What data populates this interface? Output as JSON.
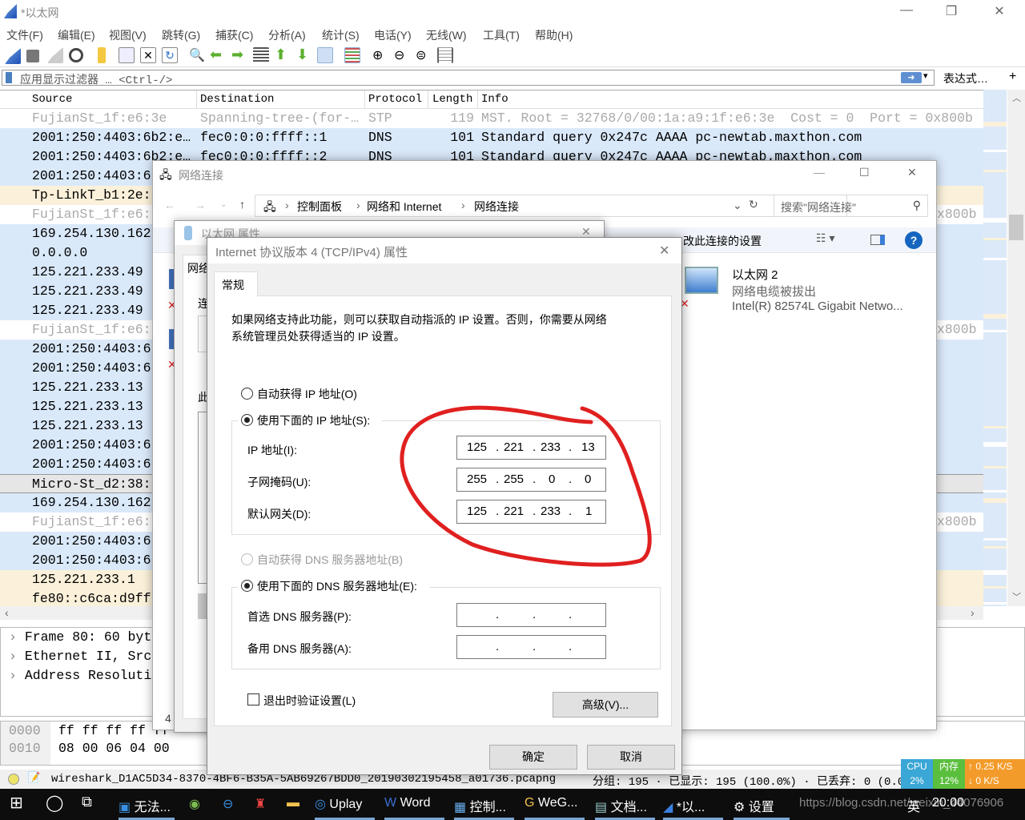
{
  "wireshark": {
    "title": "*以太网",
    "menu": [
      "文件(F)",
      "编辑(E)",
      "视图(V)",
      "跳转(G)",
      "捕获(C)",
      "分析(A)",
      "统计(S)",
      "电话(Y)",
      "无线(W)",
      "工具(T)",
      "帮助(H)"
    ],
    "filter_placeholder": "应用显示过滤器 … <Ctrl-/>",
    "expression_label": "表达式…",
    "plus_label": "+",
    "columns": {
      "source": "Source",
      "destination": "Destination",
      "protocol": "Protocol",
      "length": "Length",
      "info": "Info"
    },
    "row_colors": {
      "blue": "#dae9fa",
      "tan": "#fbf1da",
      "white": "#ffffff",
      "selected": "#e6e6e6"
    },
    "packets": [
      {
        "style": "white",
        "dim": true,
        "source": "FujianSt_1f:e6:3e",
        "destination": "Spanning-tree-(for-…",
        "protocol": "STP",
        "length": "119",
        "info": "MST. Root = 32768/0/00:1a:a9:1f:e6:3e  Cost = 0  Port = 0x800b"
      },
      {
        "style": "blue",
        "source": "2001:250:4403:6b2:e…",
        "destination": "fec0:0:0:ffff::1",
        "protocol": "DNS",
        "length": "101",
        "info": "Standard query 0x247c AAAA pc-newtab.maxthon.com"
      },
      {
        "style": "blue",
        "source": "2001:250:4403:6b2:e…",
        "destination": "fec0:0:0:ffff::2",
        "protocol": "DNS",
        "length": "101",
        "info": "Standard query 0x247c AAAA pc-newtab.maxthon.com"
      },
      {
        "style": "blue",
        "source": "2001:250:4403:6"
      },
      {
        "style": "tan",
        "source": "Tp-LinkT_b1:2e:"
      },
      {
        "style": "white",
        "dim": true,
        "source": "FujianSt_1f:e6:",
        "tail": "x800b"
      },
      {
        "style": "blue",
        "source": "169.254.130.162"
      },
      {
        "style": "blue",
        "source": "0.0.0.0"
      },
      {
        "style": "blue",
        "source": "125.221.233.49"
      },
      {
        "style": "blue",
        "source": "125.221.233.49"
      },
      {
        "style": "blue",
        "source": "125.221.233.49"
      },
      {
        "style": "white",
        "dim": true,
        "source": "FujianSt_1f:e6:",
        "tail": "x800b"
      },
      {
        "style": "blue",
        "source": "2001:250:4403:6"
      },
      {
        "style": "blue",
        "source": "2001:250:4403:6"
      },
      {
        "style": "blue",
        "source": "125.221.233.13"
      },
      {
        "style": "blue",
        "source": "125.221.233.13"
      },
      {
        "style": "blue",
        "source": "125.221.233.13"
      },
      {
        "style": "blue",
        "source": "2001:250:4403:6"
      },
      {
        "style": "blue",
        "source": "2001:250:4403:6"
      },
      {
        "style": "selected",
        "source": "Micro-St_d2:38:"
      },
      {
        "style": "blue",
        "source": "169.254.130.162"
      },
      {
        "style": "white",
        "dim": true,
        "source": "FujianSt_1f:e6:",
        "tail": "x800b"
      },
      {
        "style": "blue",
        "source": "2001:250:4403:6"
      },
      {
        "style": "blue",
        "source": "2001:250:4403:6"
      },
      {
        "style": "tan",
        "source": "125.221.233.1"
      },
      {
        "style": "tan",
        "source": "fe80::c6ca:d9ff"
      }
    ],
    "details": [
      "Frame 80: 60 byt",
      "Ethernet II, Src",
      "Address Resoluti"
    ],
    "bytes": [
      {
        "offset": "0000",
        "hex": "ff ff ff ff ff"
      },
      {
        "offset": "0010",
        "hex": "08 00 06 04 00"
      }
    ],
    "status_file": "wireshark_D1AC5D34-8370-4BF6-B35A-5AB69267BDD0_20190302195458_a01736.pcapng",
    "status_counts": "分组: 195 · 已显示: 195 (100.0%) · 已丢弃: 0 (0.0%)"
  },
  "monitor": {
    "cpu_label": "CPU",
    "cpu_value": "2%",
    "mem_label": "内存",
    "mem_value": "12%",
    "up": "0.25 K/S",
    "down": "0 K/S"
  },
  "network_window": {
    "title": "网络连接",
    "breadcrumb": [
      "控制面板",
      "网络和 Internet",
      "网络连接"
    ],
    "search_placeholder": "搜索\"网络连接\"",
    "command": "改此连接的设置",
    "adapter": {
      "name": "以太网 2",
      "status": "网络电缆被拔出",
      "device": "Intel(R) 82574L Gigabit Netwo..."
    },
    "item_count": "4"
  },
  "ethernet_props": {
    "title": "以太网 属性",
    "tab": "网络",
    "conn_label": "连",
    "items_label": "此"
  },
  "ipv4": {
    "title": "Internet 协议版本 4 (TCP/IPv4) 属性",
    "tab": "常规",
    "description": [
      "如果网络支持此功能，则可以获取自动指派的 IP 设置。否则，你需要从网络",
      "系统管理员处获得适当的 IP 设置。"
    ],
    "auto_ip": "自动获得 IP 地址(O)",
    "manual_ip": "使用下面的 IP 地址(S):",
    "ip_label": "IP 地址(I):",
    "ip": [
      "125",
      "221",
      "233",
      "13"
    ],
    "mask_label": "子网掩码(U):",
    "mask": [
      "255",
      "255",
      "0",
      "0"
    ],
    "gateway_label": "默认网关(D):",
    "gateway": [
      "125",
      "221",
      "233",
      "1"
    ],
    "auto_dns": "自动获得 DNS 服务器地址(B)",
    "manual_dns": "使用下面的 DNS 服务器地址(E):",
    "dns1_label": "首选 DNS 服务器(P):",
    "dns2_label": "备用 DNS 服务器(A):",
    "validate": "退出时验证设置(L)",
    "advanced": "高级(V)...",
    "ok": "确定",
    "cancel": "取消",
    "annotation_color": "#e02020"
  },
  "taskbar": {
    "items": [
      "无法...",
      "Uplay",
      "Word",
      "控制...",
      "WeG...",
      "文档...",
      "*以...",
      "设置"
    ],
    "ime": "英",
    "time": "20:00",
    "watermark": "https://blog.csdn.net/weixin_44076906"
  }
}
